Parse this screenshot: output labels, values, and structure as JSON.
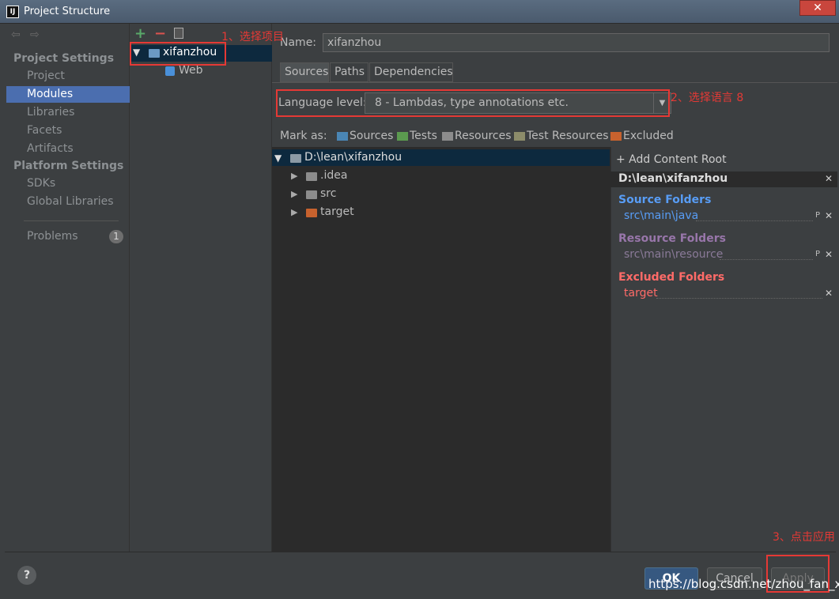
{
  "window": {
    "title": "Project Structure",
    "app_icon": "IJ",
    "close_glyph": "✕"
  },
  "nav": {
    "project_settings_header": "Project Settings",
    "project_items": [
      "Project",
      "Modules",
      "Libraries",
      "Facets",
      "Artifacts"
    ],
    "selected": "Modules",
    "platform_settings_header": "Platform Settings",
    "platform_items": [
      "SDKs",
      "Global Libraries"
    ],
    "problems_label": "Problems",
    "problems_count": "1"
  },
  "modules": {
    "add": "+",
    "remove": "−",
    "module_name": "xifanzhou",
    "facet": "Web"
  },
  "detail": {
    "name_label": "Name:",
    "name_value": "xifanzhou",
    "tabs": [
      "Sources",
      "Paths",
      "Dependencies"
    ],
    "active_tab": "Sources",
    "language_label": "Language level:",
    "language_value": "8 - Lambdas, type annotations etc.",
    "mark_as_label": "Mark as:",
    "mark_as": [
      "Sources",
      "Tests",
      "Resources",
      "Test Resources",
      "Excluded"
    ]
  },
  "tree": {
    "root": "D:\\lean\\xifanzhou",
    "children": [
      ".idea",
      "src",
      "target"
    ]
  },
  "content_root": {
    "add_label": "+ Add Content Root",
    "path": "D:\\lean\\xifanzhou",
    "source_header": "Source Folders",
    "source_path": "src\\main\\java",
    "resource_header": "Resource Folders",
    "resource_path": "src\\main\\resource",
    "excluded_header": "Excluded Folders",
    "excluded_path": "target",
    "remove_glyph": "✕",
    "props_glyph": "P"
  },
  "buttons": {
    "ok": "OK",
    "cancel": "Cancel",
    "apply": "Apply",
    "help": "?"
  },
  "annotations": {
    "step1": "1、选择项目",
    "step2": "2、选择语言 8",
    "step3": "3、点击应用"
  },
  "watermark": "https://blog.csdn.net/zhou_fan_xi",
  "colors": {
    "accent": "#4b6eaf",
    "source_folders": "#589df6",
    "resource_folders": "#9876aa",
    "excluded_folders": "#ff6b68",
    "annotation_red": "#e53935"
  }
}
